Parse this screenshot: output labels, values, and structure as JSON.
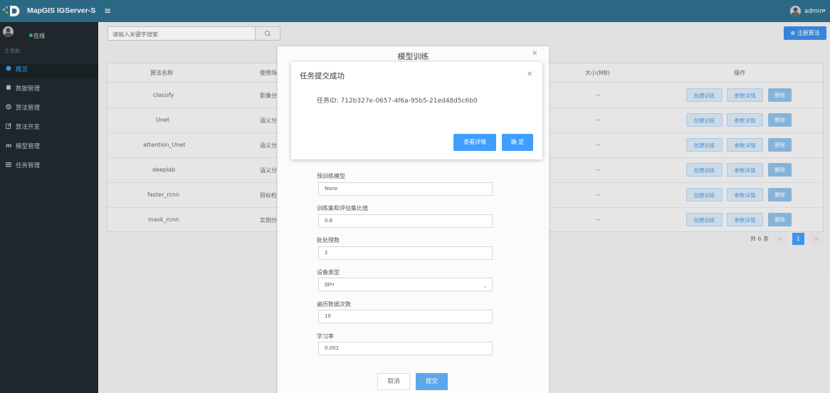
{
  "app": {
    "title": "MapGIS IGServer-S"
  },
  "user": {
    "name": "admin",
    "status": "在线"
  },
  "sidebar": {
    "section": "主导航",
    "items": [
      {
        "label": "概览",
        "icon": "overview-icon"
      },
      {
        "label": "数据管理",
        "icon": "database-icon"
      },
      {
        "label": "算法管理",
        "icon": "gear-icon"
      },
      {
        "label": "算法开发",
        "icon": "edit-icon"
      },
      {
        "label": "模型管理",
        "icon": "model-icon"
      },
      {
        "label": "任务管理",
        "icon": "task-list-icon"
      }
    ]
  },
  "toolbar": {
    "search_placeholder": "请输入关键字搜索",
    "register_label": "⊕ 注册算法"
  },
  "table": {
    "headers": {
      "name": "算法名称",
      "usage": "使用场",
      "size": "大小(MB)",
      "ops": "操作"
    },
    "rows": [
      {
        "name": "classify",
        "usage": "影像分",
        "size": "--"
      },
      {
        "name": "Unet",
        "usage": "语义分",
        "size": "--"
      },
      {
        "name": "attention_Unet",
        "usage": "语义分",
        "size": "--"
      },
      {
        "name": "deeplab",
        "usage": "语义分",
        "size": "--"
      },
      {
        "name": "faster_rcnn",
        "usage": "目标检",
        "size": "--"
      },
      {
        "name": "mask_rcnn",
        "usage": "实例分",
        "size": "--"
      }
    ],
    "actions": {
      "create": "创建训练",
      "params": "参数详情",
      "delete": "删除"
    }
  },
  "pager": {
    "total": "共 6 条",
    "current": "1",
    "prev": "<",
    "next": ">"
  },
  "train_modal": {
    "title": "模型训练",
    "fields": [
      {
        "label": "预训练模型",
        "value": "None"
      },
      {
        "label": "训练集和评估集比值",
        "value": "0.8"
      },
      {
        "label": "批处理数",
        "value": "2"
      },
      {
        "label": "设备类型",
        "value": "gpu"
      },
      {
        "label": "遍历数据次数",
        "value": "10"
      },
      {
        "label": "学习率",
        "value": "0.001"
      }
    ],
    "cancel": "取消",
    "submit": "提交"
  },
  "success_dialog": {
    "title": "任务提交成功",
    "message": "任务ID: 712b327e-0657-4f6a-95b5-21ed48d5c6b0",
    "detail_button": "查看详情",
    "ok_button": "确 定"
  },
  "colors": {
    "topbar": "#2d6f8f",
    "sidebar": "#212a2f",
    "primary": "#409eff"
  }
}
